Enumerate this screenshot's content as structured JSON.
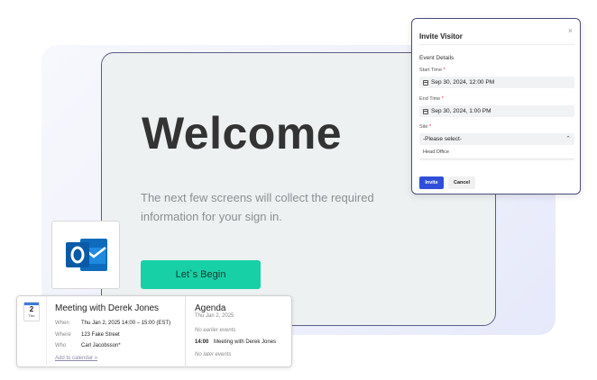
{
  "kiosk": {
    "welcome": "Welcome",
    "intro": "The next few screens will collect the required information for your sign in.",
    "begin_button": "Let`s Begin",
    "accent_color": "#18d0a6"
  },
  "dialog": {
    "title": "Invite Visitor",
    "close_glyph": "×",
    "section": "Event Details",
    "start_label": "Start Time",
    "start_value": "Sep 30, 2024, 12:00 PM",
    "end_label": "End Time",
    "end_value": "Sep 30, 2024, 1:00 PM",
    "site_label": "Site",
    "site_value": "-Please select-",
    "site_option": "Head Office",
    "required_mark": "*",
    "invite_button": "Invite",
    "cancel_button": "Cancel",
    "primary_color": "#2f4fd8"
  },
  "outlook": {
    "icon": "outlook-logo-icon",
    "brand_color": "#0f6cbd"
  },
  "invite_card": {
    "badge_day": "2",
    "badge_weekday": "Thu",
    "title": "Meeting with Derek Jones",
    "when_label": "When",
    "when_value": "Thu Jan 2, 2025 14:00 – 15:00 (EST)",
    "where_label": "Where",
    "where_value": "123 Fake Street",
    "who_label": "Who",
    "who_value": "Carl Jacobsson*",
    "add_calendar": "Add to calendar »"
  },
  "agenda": {
    "title": "Agenda",
    "date": "Thu Jan 2, 2025",
    "no_earlier": "No earlier events",
    "event_time": "14:00",
    "event_title": "Meeting with Derek Jones",
    "no_later": "No later events"
  }
}
